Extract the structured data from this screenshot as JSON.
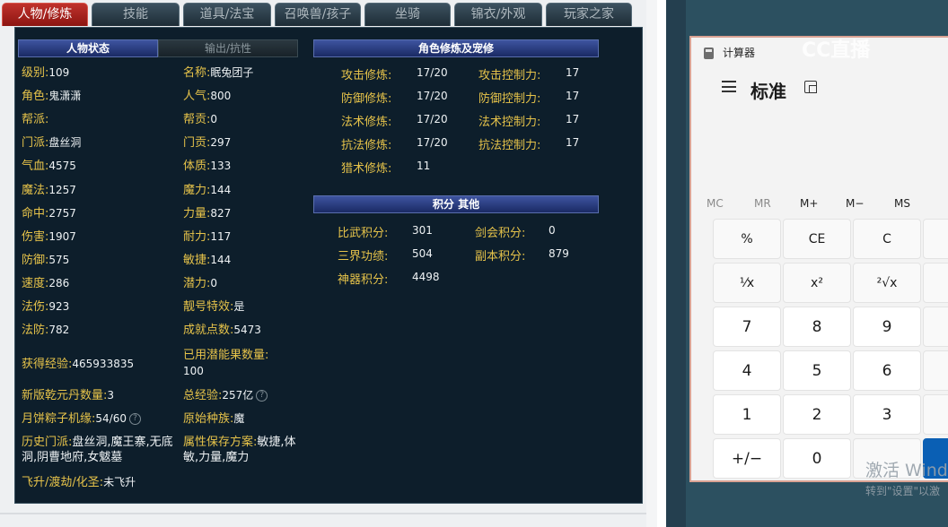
{
  "tabs": [
    "人物/修炼",
    "技能",
    "道具/法宝",
    "召唤兽/孩子",
    "坐骑",
    "锦衣/外观",
    "玩家之家"
  ],
  "status_tabs": {
    "active": "人物状态",
    "inactive": "输出/抗性"
  },
  "char": {
    "left": [
      {
        "label": "级别:",
        "value": "109"
      },
      {
        "label": "角色:",
        "value": "鬼潇潇"
      },
      {
        "label": "帮派:",
        "value": ""
      },
      {
        "label": "门派:",
        "value": "盘丝洞"
      },
      {
        "label": "气血:",
        "value": "4575"
      },
      {
        "label": "魔法:",
        "value": "1257"
      },
      {
        "label": "命中:",
        "value": "2757"
      },
      {
        "label": "伤害:",
        "value": "1907"
      },
      {
        "label": "防御:",
        "value": "575"
      },
      {
        "label": "速度:",
        "value": "286"
      },
      {
        "label": "法伤:",
        "value": "923"
      },
      {
        "label": "法防:",
        "value": "782"
      }
    ],
    "right": [
      {
        "label": "名称:",
        "value": "眠兔团子"
      },
      {
        "label": "人气:",
        "value": "800"
      },
      {
        "label": "帮贡:",
        "value": "0"
      },
      {
        "label": "门贡:",
        "value": "297"
      },
      {
        "label": "体质:",
        "value": "133"
      },
      {
        "label": "魔力:",
        "value": "144"
      },
      {
        "label": "力量:",
        "value": "827"
      },
      {
        "label": "耐力:",
        "value": "117"
      },
      {
        "label": "敏捷:",
        "value": "144"
      },
      {
        "label": "潜力:",
        "value": "0"
      },
      {
        "label": "靓号特效:",
        "value": "是"
      },
      {
        "label": "成就点数:",
        "value": "5473"
      }
    ],
    "exp_label": "获得经验:",
    "exp_value": "465933835",
    "potion_label": "已用潜能果数量:",
    "potion_value": "100",
    "qianyuan_label": "新版乾元丹数量:",
    "qianyuan_value": "3",
    "total_exp_label": "总经验:",
    "total_exp_value": "257亿",
    "zongzi_label": "月饼粽子机缘:",
    "zongzi_value": "54/60",
    "race_label": "原始种族:",
    "race_value": "魔",
    "history_label": "历史门派:",
    "history_value": "盘丝洞,魔王寨,无底洞,阴曹地府,女魃墓",
    "attr_save_label": "属性保存方案:",
    "attr_save_value": "敏捷,体敏,力量,魔力",
    "ascend_label": "飞升/渡劫/化圣:",
    "ascend_value": "未飞升"
  },
  "cultivation": {
    "header": "角色修炼及宠修",
    "rows": [
      {
        "label": "攻击修炼:",
        "value": "17/20",
        "label2": "攻击控制力:",
        "value2": "17"
      },
      {
        "label": "防御修炼:",
        "value": "17/20",
        "label2": "防御控制力:",
        "value2": "17"
      },
      {
        "label": "法术修炼:",
        "value": "17/20",
        "label2": "法术控制力:",
        "value2": "17"
      },
      {
        "label": "抗法修炼:",
        "value": "17/20",
        "label2": "抗法控制力:",
        "value2": "17"
      },
      {
        "label": "猎术修炼:",
        "value": "11",
        "label2": "",
        "value2": ""
      }
    ]
  },
  "points": {
    "header": "积分 其他",
    "rows": [
      {
        "label": "比武积分:",
        "value": "301",
        "label2": "剑会积分:",
        "value2": "0"
      },
      {
        "label": "三界功绩:",
        "value": "504",
        "label2": "副本积分:",
        "value2": "879"
      },
      {
        "label": "神器积分:",
        "value": "4498",
        "label2": "",
        "value2": ""
      }
    ]
  },
  "calculator": {
    "title": "计算器",
    "mode": "标准",
    "memory": [
      "MC",
      "MR",
      "M+",
      "M−",
      "MS"
    ],
    "keys": [
      [
        "%",
        "CE",
        "C"
      ],
      [
        "¹⁄x",
        "x²",
        "²√x"
      ],
      [
        "7",
        "8",
        "9"
      ],
      [
        "4",
        "5",
        "6"
      ],
      [
        "1",
        "2",
        "3"
      ],
      [
        "+/−",
        "0",
        ""
      ]
    ]
  },
  "watermark": "CC直播",
  "activation": {
    "line1": "激活 Windo",
    "line2": "转到\"设置\"以激"
  }
}
